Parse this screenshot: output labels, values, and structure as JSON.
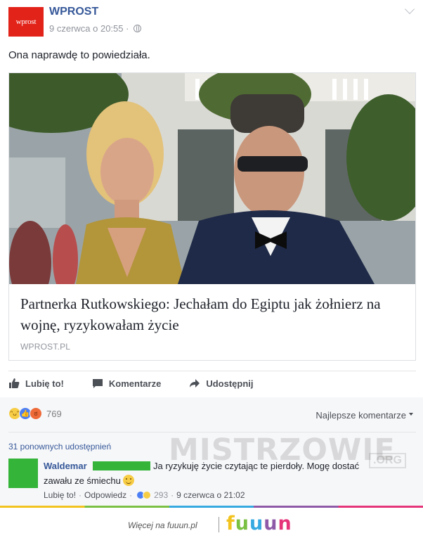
{
  "post": {
    "logo_text": "wprost",
    "page_name": "WPROST",
    "timestamp": "9 czerwca o 20:55 ·",
    "text": "Ona naprawdę to powiedziała."
  },
  "link_card": {
    "title": "Partnerka Rutkowskiego: Jechałam do Egiptu jak żołnierz na wojnę, ryzykowałam życie",
    "domain": "WPROST.PL"
  },
  "actions": {
    "like": "Lubię to!",
    "comment": "Komentarze",
    "share": "Udostępnij"
  },
  "reactions": {
    "count": "769",
    "sort_label": "Najlepsze komentarze",
    "types": [
      "haha",
      "like",
      "angry"
    ]
  },
  "shares_text": "31 ponownych udostępnień",
  "comment": {
    "author": "Waldemar",
    "text_line1": "Ja ryzykuję życie czytając te pierdoły. Mogę dostać",
    "text_line2": "zawału ze śmiechu",
    "like_label": "Lubię to!",
    "reply_label": "Odpowiedz",
    "reaction_count": "293",
    "time": "9 czerwca o 21:02"
  },
  "watermark": {
    "text": "MISTRZOWIE",
    "tld": ".ORG"
  },
  "footer": {
    "tagline": "Więcej na fuuun.pl",
    "brand": [
      "f",
      "u",
      "u",
      "u",
      "n"
    ]
  },
  "colors": {
    "link_blue": "#365899",
    "logo_red": "#e2231a",
    "avatar_green": "#34b439"
  }
}
